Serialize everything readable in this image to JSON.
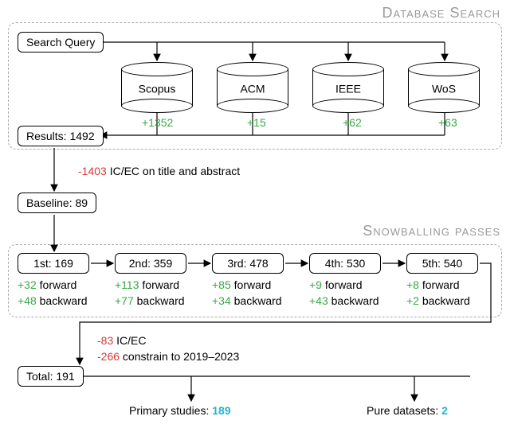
{
  "sections": {
    "database_search": "Database Search",
    "snowballing": "Snowballing passes"
  },
  "search_query": "Search Query",
  "dbs": {
    "scopus": {
      "name": "Scopus",
      "count": "+1352"
    },
    "acm": {
      "name": "ACM",
      "count": "+15"
    },
    "ieee": {
      "name": "IEEE",
      "count": "+62"
    },
    "wos": {
      "name": "WoS",
      "count": "+63"
    }
  },
  "results": {
    "label": "Results: 1492"
  },
  "icec_title": {
    "count": "-1403",
    "text": " IC/EC on title and abstract"
  },
  "baseline": {
    "label": "Baseline: 89"
  },
  "passes": {
    "p1": {
      "label": "1st: 169",
      "fwd_n": "+32",
      "fwd_t": " forward",
      "bwd_n": "+48",
      "bwd_t": " backward"
    },
    "p2": {
      "label": "2nd: 359",
      "fwd_n": "+113",
      "fwd_t": " forward",
      "bwd_n": "+77",
      "bwd_t": " backward"
    },
    "p3": {
      "label": "3rd: 478",
      "fwd_n": "+85",
      "fwd_t": " forward",
      "bwd_n": "+34",
      "bwd_t": " backward"
    },
    "p4": {
      "label": "4th: 530",
      "fwd_n": "+9",
      "fwd_t": " forward",
      "bwd_n": "+43",
      "bwd_t": " backward"
    },
    "p5": {
      "label": "5th: 540",
      "fwd_n": "+8",
      "fwd_t": " forward",
      "bwd_n": "+2",
      "bwd_t": " backward"
    }
  },
  "icec2": {
    "count": "-83",
    "text": " IC/EC"
  },
  "constrain": {
    "count": "-266",
    "text": " constrain to 2019–2023"
  },
  "total": {
    "label": "Total: 191"
  },
  "outputs": {
    "primary": {
      "label": "Primary studies: ",
      "value": "189"
    },
    "datasets": {
      "label": "Pure datasets: ",
      "value": "2"
    }
  }
}
